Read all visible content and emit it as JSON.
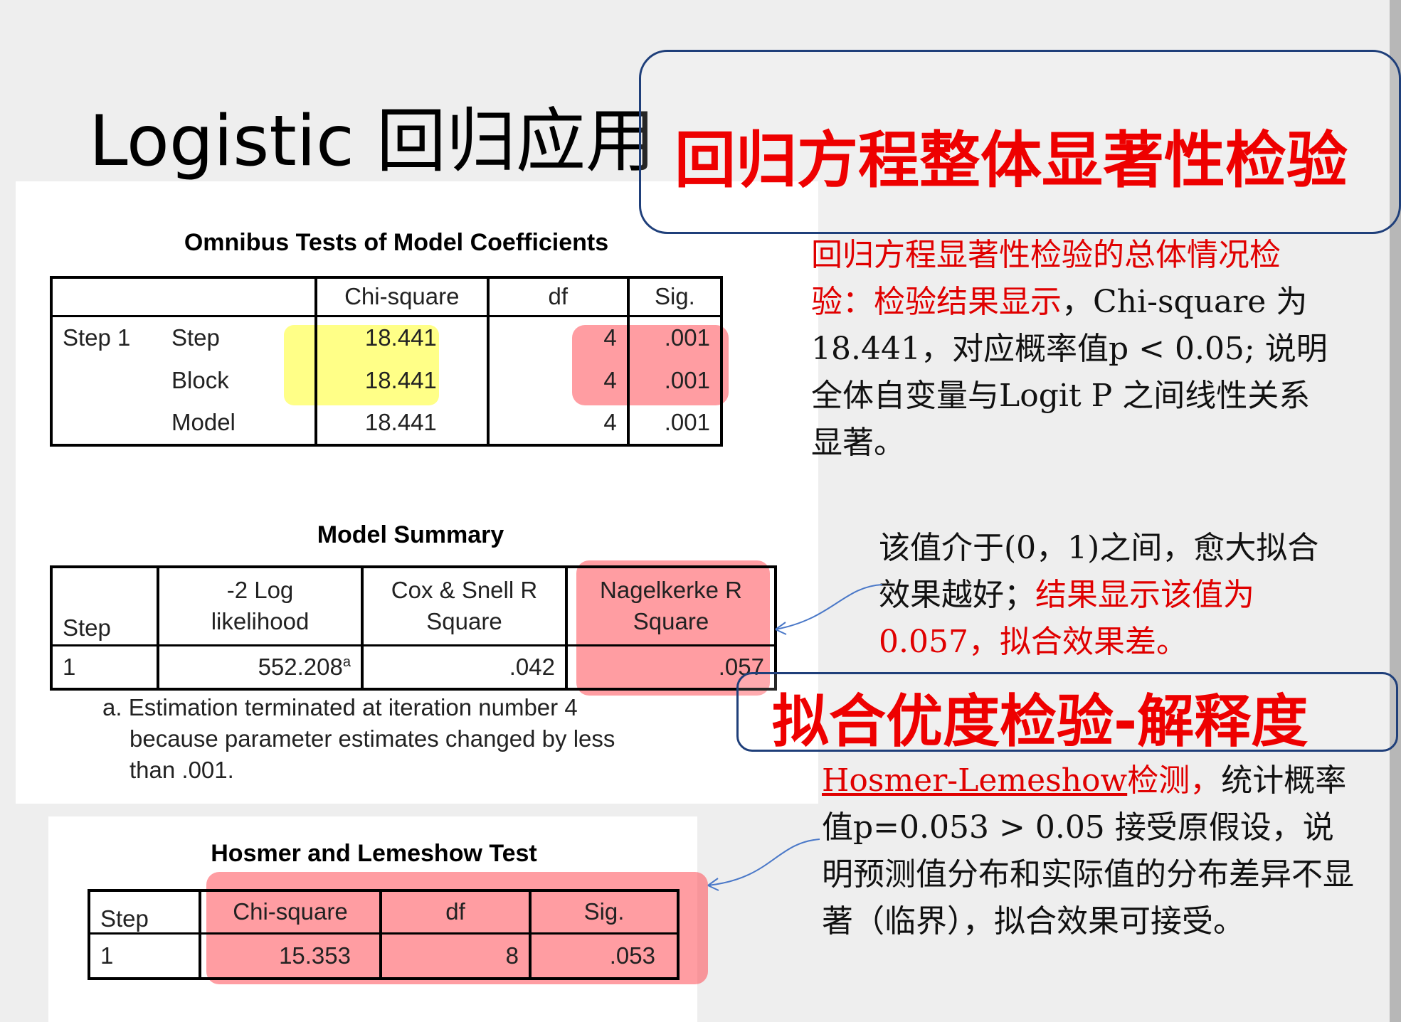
{
  "slide": {
    "title": "Logistic 回归应用"
  },
  "callouts": {
    "overall_test": "回归方程整体显著性检验",
    "goodness_fit": "拟合优度检验-解释度"
  },
  "omnibus": {
    "title": "Omnibus Tests of Model Coefficients",
    "headers": [
      "Chi-square",
      "df",
      "Sig."
    ],
    "step_label": "Step 1",
    "rows": [
      {
        "label": "Step",
        "chi": "18.441",
        "df": "4",
        "sig": ".001"
      },
      {
        "label": "Block",
        "chi": "18.441",
        "df": "4",
        "sig": ".001"
      },
      {
        "label": "Model",
        "chi": "18.441",
        "df": "4",
        "sig": ".001"
      }
    ]
  },
  "model_summary": {
    "title": "Model Summary",
    "headers": {
      "step": "Step",
      "loglik_1": "-2 Log",
      "loglik_2": "likelihood",
      "cox_1": "Cox & Snell R",
      "cox_2": "Square",
      "nagel_1": "Nagelkerke R",
      "nagel_2": "Square"
    },
    "row": {
      "step": "1",
      "loglik": "552.208",
      "loglik_sup": "a",
      "cox": ".042",
      "nagel": ".057"
    },
    "footnote_1": "a. Estimation terminated at iteration number 4",
    "footnote_2": "because parameter estimates changed by less",
    "footnote_3": "than .001."
  },
  "hosmer": {
    "title": "Hosmer and Lemeshow Test",
    "headers": [
      "Step",
      "Chi-square",
      "df",
      "Sig."
    ],
    "row": {
      "step": "1",
      "chi": "15.353",
      "df": "8",
      "sig": ".053"
    }
  },
  "notes": {
    "note1": {
      "red_part": "回归方程显著性检验的总体情况检验：检验结果显示",
      "black_part": "，Chi-square 为18.441，对应概率值p < 0.05; 说明全体自变量与Logit P 之间线性关系显著。"
    },
    "note2": {
      "black_part": "该值介于(0，1)之间，愈大拟合效果越好；",
      "red_part": "结果显示该值为0.057，拟合效果差。"
    },
    "note3": {
      "red_underlined": "Hosmer-Lemeshow",
      "red_part": "检测，",
      "black_part": "统计概率值p=0.053 > 0.05 接受原假设，说明预测值分布和实际值的分布差异不显著（临界），拟合效果可接受。"
    }
  }
}
